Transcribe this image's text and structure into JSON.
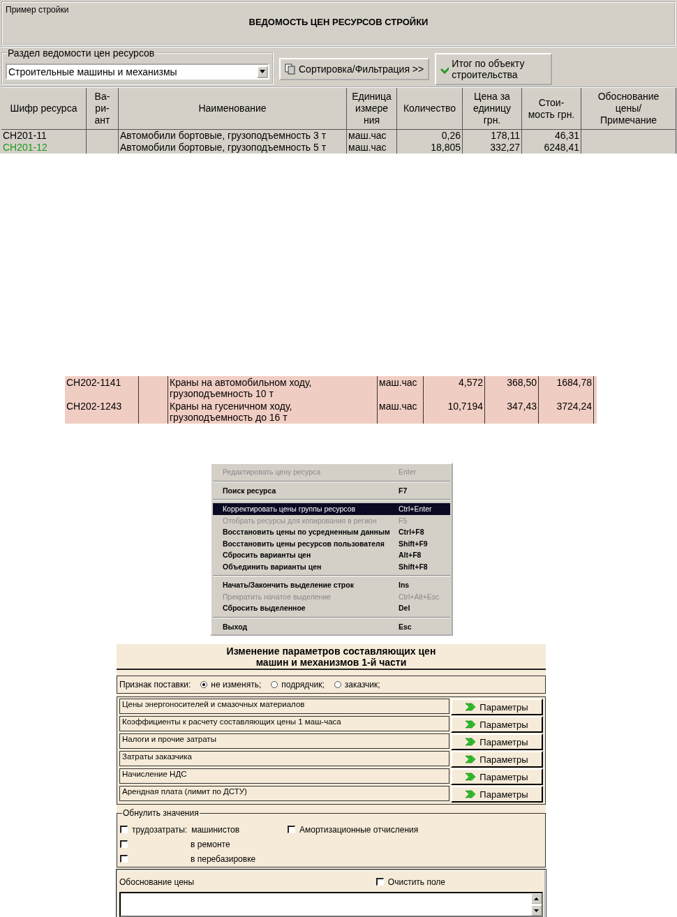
{
  "window": {
    "title": "Пример стройки",
    "heading": "ВЕДОМОСТЬ ЦЕН РЕСУРСОВ СТРОЙКИ"
  },
  "toolbar": {
    "section_label": "Раздел ведомости цен ресурсов",
    "section_value": "Строительные машины и механизмы",
    "sort_button": "Сортировка/Фильтрация >>",
    "total_button": "Итог по объекту строительства"
  },
  "table": {
    "columns": [
      "Шифр ресурса",
      "Ва-ри-ант",
      "Наименование",
      "Единица измере ния",
      "Количество",
      "Цена за единицу грн.",
      "Стои-мость грн.",
      "Обоснование цены/ Примечание"
    ],
    "rows": [
      {
        "code": "СН201-11",
        "color": "#000000",
        "variant": "",
        "name": "Автомобили бортовые, грузоподъемность 3 т",
        "unit": "маш.час",
        "qty": "0,26",
        "price": "178,11",
        "cost": "46,31",
        "note": ""
      },
      {
        "code": "СН201-12",
        "color": "#1a9a1a",
        "variant": "",
        "name": "Автомобили бортовые, грузоподъемность 5 т",
        "unit": "маш.час",
        "qty": "18,805",
        "price": "332,27",
        "cost": "6248,41",
        "note": ""
      }
    ]
  },
  "snippet_table": {
    "rows": [
      {
        "code": "СН202-1141",
        "variant": "",
        "name": "Краны на автомобильном ходу, грузоподъемность 10 т",
        "unit": "маш.час",
        "qty": "4,572",
        "price": "368,50",
        "cost": "1684,78"
      },
      {
        "code": "СН202-1243",
        "variant": "",
        "name": "Краны на гусеничном ходу, грузоподъемность до 16 т",
        "unit": "маш.час",
        "qty": "10,7194",
        "price": "347,43",
        "cost": "3724,24"
      }
    ]
  },
  "context_menu": {
    "groups": [
      [
        {
          "label": "Редактировать цену ресурса",
          "shortcut": "Enter",
          "disabled": true,
          "selected": false
        }
      ],
      [
        {
          "label": "Поиск ресурса",
          "shortcut": "F7",
          "disabled": false,
          "selected": false
        }
      ],
      [
        {
          "label": "Корректировать цены группы ресурсов",
          "shortcut": "Ctrl+Enter",
          "disabled": false,
          "selected": true
        },
        {
          "label": "Отобрать ресурсы для копирования в регион",
          "shortcut": "F5",
          "disabled": true,
          "selected": false
        },
        {
          "label": "Восстановить цены по усредненным данным",
          "shortcut": "Ctrl+F8",
          "disabled": false,
          "selected": false
        },
        {
          "label": "Восстановить цены ресурсов пользователя",
          "shortcut": "Shift+F9",
          "disabled": false,
          "selected": false
        },
        {
          "label": "Сбросить варианты цен",
          "shortcut": "Alt+F8",
          "disabled": false,
          "selected": false
        },
        {
          "label": "Объединить варианты цен",
          "shortcut": "Shift+F8",
          "disabled": false,
          "selected": false
        }
      ],
      [
        {
          "label": "Начать/Закончить выделение строк",
          "shortcut": "Ins",
          "disabled": false,
          "selected": false
        },
        {
          "label": "Прекратить начатое выделение",
          "shortcut": "Ctrl+Alt+Esc",
          "disabled": true,
          "selected": false
        },
        {
          "label": "Сбросить выделенное",
          "shortcut": "Del",
          "disabled": false,
          "selected": false
        }
      ],
      [
        {
          "label": "Выход",
          "shortcut": "Esc",
          "disabled": false,
          "selected": false
        }
      ]
    ]
  },
  "dialog": {
    "title": [
      "Изменение параметров составляющих цен",
      "машин и механизмов 1-й части"
    ],
    "supply": {
      "label": "Признак поставки:",
      "options": [
        {
          "label": "не изменять;",
          "selected": true
        },
        {
          "label": "подрядчик;",
          "selected": false
        },
        {
          "label": "заказчик;",
          "selected": false
        }
      ]
    },
    "parameters": [
      {
        "label": "Цены энергоносителей и смазочных материалов",
        "button": "Параметры"
      },
      {
        "label": "Коэффициенты к расчету составляющих цены 1 маш-часа",
        "button": "Параметры"
      },
      {
        "label": "Налоги и прочие затраты",
        "button": "Параметры"
      },
      {
        "label": "Затраты заказчика",
        "button": "Параметры"
      },
      {
        "label": "Начисление НДС",
        "button": "Параметры"
      },
      {
        "label": "Арендная плата (лимит по ДСТУ)",
        "button": "Параметры"
      }
    ],
    "reset": {
      "title": "Обнулить значения",
      "left": [
        {
          "label": "трудозатраты:",
          "sublabel": "машинистов",
          "checked": false
        },
        {
          "sublabel": "в ремонте",
          "checked": false
        },
        {
          "sublabel": "в перебазировке",
          "checked": false
        }
      ],
      "right": [
        {
          "label": "Амортизационные отчисления",
          "checked": false
        }
      ]
    },
    "justification": {
      "label": "Обоснование цены",
      "clear": {
        "label": "Очистить поле",
        "checked": false
      }
    }
  }
}
